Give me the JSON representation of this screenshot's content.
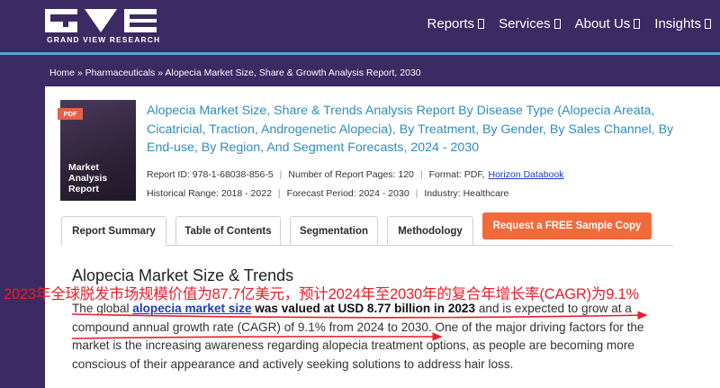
{
  "header": {
    "logo_text": "GRAND VIEW RESEARCH",
    "nav": [
      {
        "label": "Reports"
      },
      {
        "label": "Services"
      },
      {
        "label": "About Us"
      },
      {
        "label": "Insights"
      }
    ]
  },
  "breadcrumb": "Home » Pharmaceuticals » Alopecia Market Size, Share & Growth Analysis Report, 2030",
  "report": {
    "badge": "PDF",
    "cover_text": "Market Analysis Report",
    "title": "Alopecia Market Size, Share & Trends Analysis Report By Disease Type (Alopecia Areata, Cicatricial, Traction, Androgenetic Alopecia), By Treatment, By Gender, By Sales Channel, By End-use, By Region, And Segment Forecasts, 2024 - 2030",
    "id": "Report ID: 978-1-68038-856-5",
    "pages": "Number of Report Pages: 120",
    "format": "Format: PDF,",
    "format_link": "Horizon Databook",
    "historical": "Historical Range: 2018 - 2022",
    "forecast": "Forecast Period: 2024 - 2030",
    "industry": "Industry: Healthcare"
  },
  "tabs": {
    "summary": "Report Summary",
    "toc": "Table of Contents",
    "segmentation": "Segmentation",
    "methodology": "Methodology",
    "sample": "Request a FREE Sample Copy"
  },
  "section": {
    "title": "Alopecia Market Size & Trends",
    "annotation": "2023年全球脱发市场规模价值为87.7亿美元，预计2024年至2030年的复合年增长率(CAGR)为9.1%",
    "p1": "The global ",
    "link": "alopecia market size",
    "p2": " was valued at USD 8.77 billion in 2023",
    "p3": " and is expected to grow at a compound annual growth rate (CAGR) of 9.1% from 2024 to 2030. One of the major driving factors for the market is the increasing awareness regarding alopecia treatment options, as people are becoming more conscious of their appearance and actively seeking solutions to address hair loss."
  },
  "colors": {
    "header": "#3b2a63",
    "accent_line": "#5a9fd6",
    "title": "#2d8dbd",
    "cta": "#f36a3a",
    "annotation": "#e8202a"
  }
}
